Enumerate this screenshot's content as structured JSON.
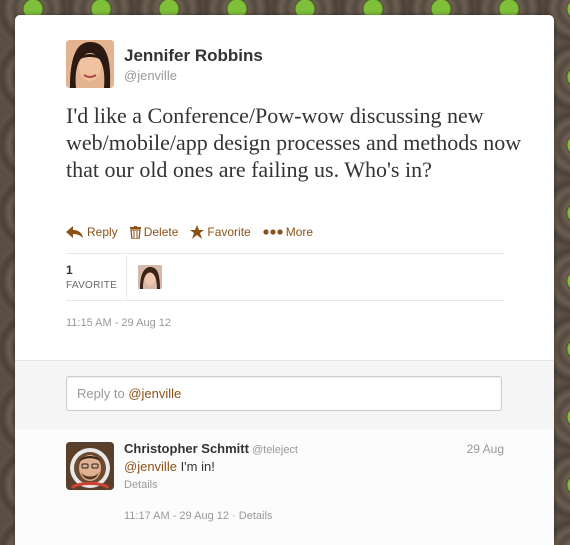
{
  "tweet": {
    "author_name": "Jennifer Robbins",
    "author_handle": "@jenville",
    "text": "I'd like a Conference/Pow-wow discussing new web/mobile/app design processes and methods now that our old ones are failing us. Who's in?",
    "actions": {
      "reply": "Reply",
      "delete": "Delete",
      "favorite": "Favorite",
      "more": "More"
    },
    "favorite_count": "1",
    "favorite_label": "FAVORITE",
    "timestamp": "11:15 AM - 29 Aug 12"
  },
  "reply_box": {
    "prefix": "Reply to ",
    "mention": "@jenville"
  },
  "reply": {
    "author_name": "Christopher Schmitt",
    "author_handle": "@teleject",
    "date": "29 Aug",
    "mention": "@jenville",
    "text": " I'm in!",
    "details": "Details",
    "timestamp": "11:17 AM - 29 Aug 12 · Details"
  },
  "colors": {
    "link": "#8b5216",
    "accent_green": "#7fbf3a"
  },
  "icons": {
    "reply": "reply-arrow-icon",
    "delete": "trash-icon",
    "favorite": "star-icon",
    "more": "ellipsis-icon"
  }
}
